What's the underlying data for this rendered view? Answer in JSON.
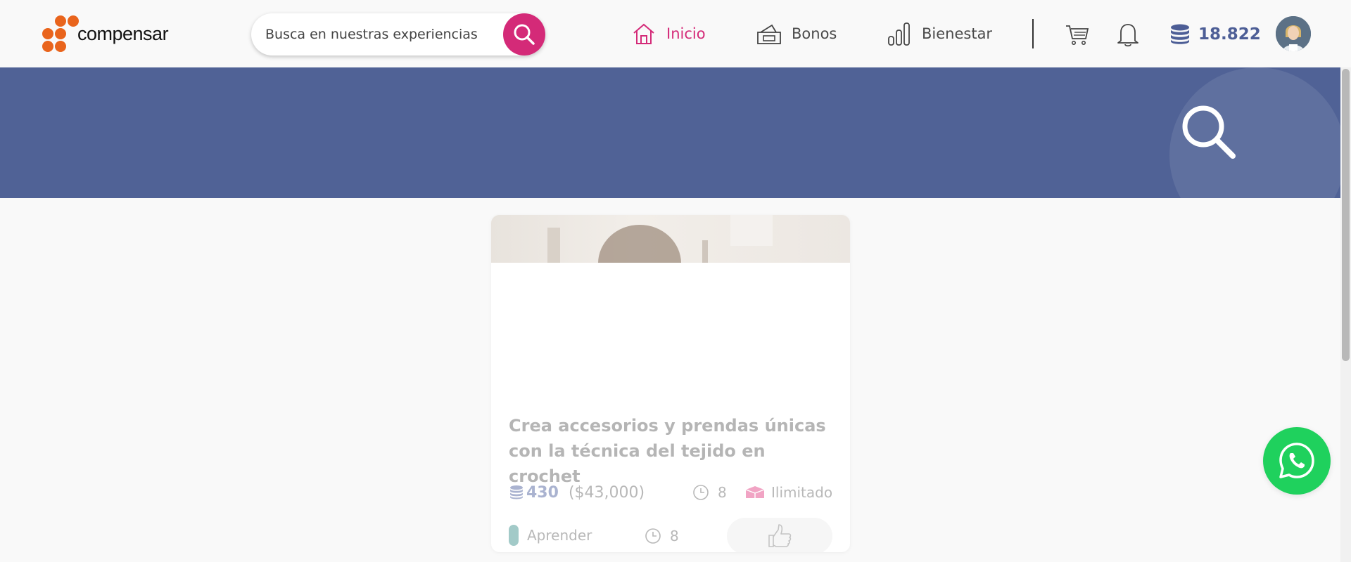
{
  "header": {
    "logo_text": "compensar",
    "search": {
      "placeholder": "Busca en nuestras experiencias"
    },
    "nav": [
      {
        "label": "Inicio",
        "icon": "home-icon",
        "active": true
      },
      {
        "label": "Bonos",
        "icon": "voucher-icon",
        "active": false
      },
      {
        "label": "Bienestar",
        "icon": "bar-chart-icon",
        "active": false
      }
    ],
    "points_balance": "18.822"
  },
  "card": {
    "title": "Crea accesorios y prendas únicas con la técnica del tejido en crochet",
    "points": "430",
    "price": "($43,000)",
    "duration": "8",
    "availability": "Ilimitado",
    "category": "Aprender",
    "duration_secondary": "8"
  },
  "colors": {
    "brand_orange": "#e9641c",
    "accent_pink": "#d42a78",
    "banner_blue": "#506296",
    "points_blue": "#4d5e96",
    "whatsapp_green": "#1fd15d"
  }
}
